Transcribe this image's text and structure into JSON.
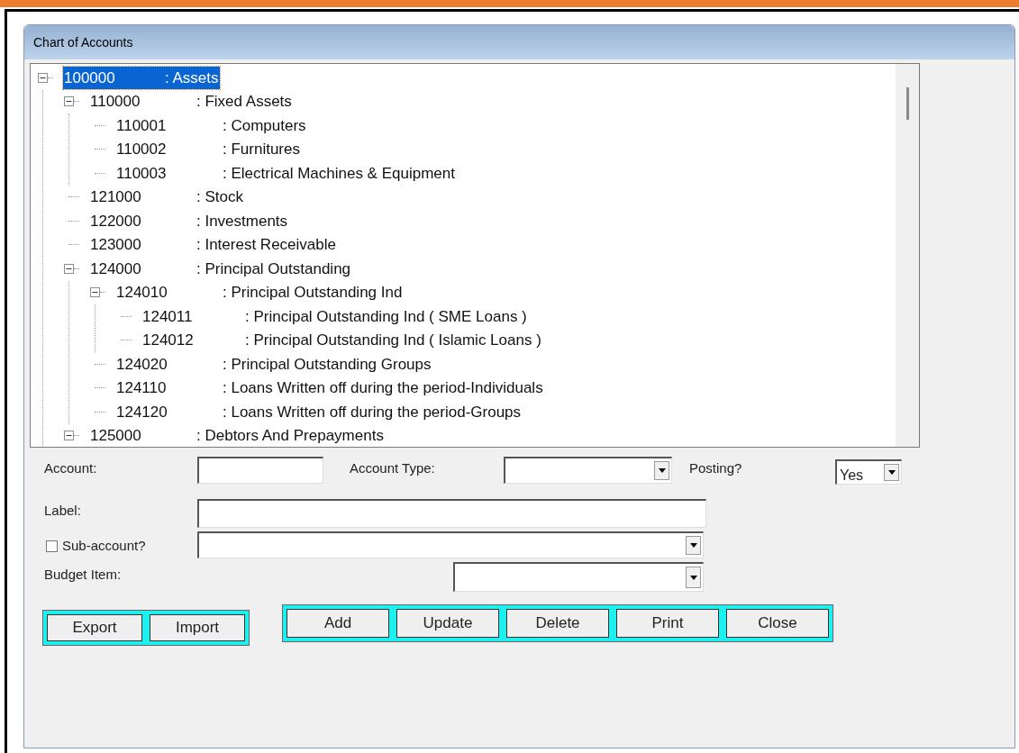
{
  "window": {
    "title": "Chart of Accounts"
  },
  "tree": [
    {
      "code": "100000",
      "label": ": Assets",
      "selected": true,
      "expanded": true,
      "children": [
        {
          "code": "110000",
          "label": ": Fixed Assets",
          "selected": false,
          "expanded": true,
          "children": [
            {
              "code": "110001",
              "label": ": Computers",
              "selected": false
            },
            {
              "code": "110002",
              "label": ": Furnitures",
              "selected": false
            },
            {
              "code": "110003",
              "label": ": Electrical Machines & Equipment",
              "selected": false
            }
          ]
        },
        {
          "code": "121000",
          "label": ": Stock",
          "selected": false
        },
        {
          "code": "122000",
          "label": ": Investments",
          "selected": false
        },
        {
          "code": "123000",
          "label": ": Interest Receivable",
          "selected": false
        },
        {
          "code": "124000",
          "label": ": Principal Outstanding",
          "selected": false,
          "expanded": true,
          "children": [
            {
              "code": "124010",
              "label": ": Principal Outstanding Ind",
              "selected": false,
              "expanded": true,
              "children": [
                {
                  "code": "124011",
                  "label": ": Principal Outstanding Ind ( SME Loans )",
                  "selected": false
                },
                {
                  "code": "124012",
                  "label": ": Principal Outstanding Ind ( Islamic Loans )",
                  "selected": false
                }
              ]
            },
            {
              "code": "124020",
              "label": ": Principal Outstanding Groups",
              "selected": false
            },
            {
              "code": "124110",
              "label": ": Loans Written off during the period-Individuals",
              "selected": false
            },
            {
              "code": "124120",
              "label": ": Loans Written off during the period-Groups",
              "selected": false
            }
          ]
        },
        {
          "code": "125000",
          "label": ": Debtors And Prepayments",
          "selected": false,
          "expanded": true
        }
      ]
    }
  ],
  "form": {
    "account": {
      "label": "Account:"
    },
    "account_type": {
      "label": "Account Type:"
    },
    "posting": {
      "label": "Posting?",
      "value": "Yes"
    },
    "label": {
      "label": "Label:"
    },
    "sub_account": {
      "label": "Sub-account?",
      "checked": false
    },
    "budget_item": {
      "label": "Budget Item:"
    }
  },
  "button_groups": [
    [
      "Export",
      "Import"
    ],
    [
      "Add",
      "Update",
      "Delete",
      "Print",
      "Close"
    ]
  ]
}
